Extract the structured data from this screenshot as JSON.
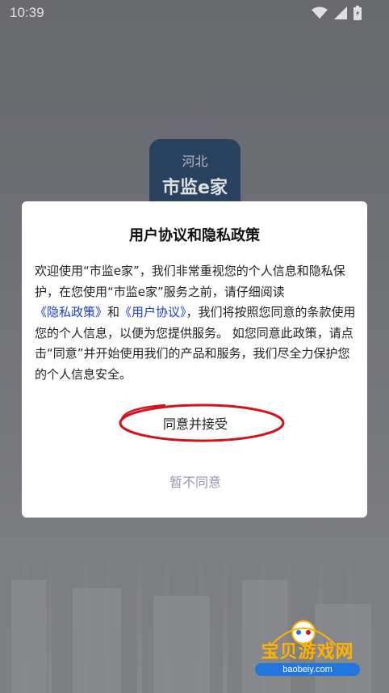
{
  "status_bar": {
    "time": "10:39",
    "icons": [
      "wifi-icon",
      "signal-icon",
      "battery-charging-icon"
    ]
  },
  "background_app": {
    "icon_line1": "河北",
    "icon_line2": "市监e家"
  },
  "dialog": {
    "title": "用户协议和隐私政策",
    "body_part1": "欢迎使用“市监e家”，我们非常重视您的个人信息和隐私保护，在您使用“市监e家”服务之前，请仔细阅读",
    "privacy_link": "《隐私政策》",
    "body_and": "和",
    "agreement_link": "《用户协议》",
    "body_part2": "，我们将按照您同意的条款使用您的个人信息，以便为您提供服务。 如您同意此政策，请点击“同意”并开始使用我们的产品和服务，我们尽全力保护您的个人信息安全。",
    "accept_label": "同意并接受",
    "decline_label": "暂不同意",
    "link_color": "#1a3fd1",
    "decline_color": "#9a97b5",
    "annotation_color": "#d4121b"
  },
  "watermark": {
    "title": "宝贝游戏网",
    "url": "baobeiy.com"
  }
}
